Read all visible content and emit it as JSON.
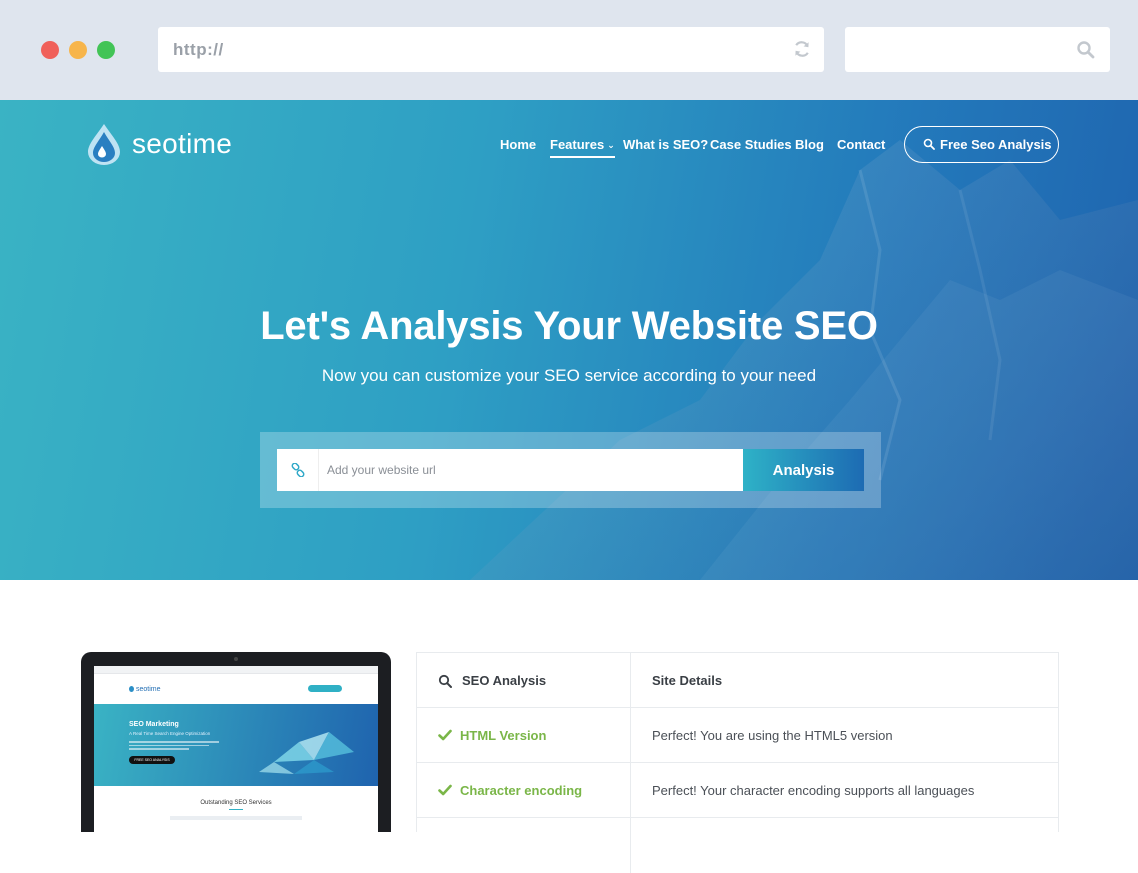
{
  "browser": {
    "url": "http://",
    "search_value": ""
  },
  "site": {
    "logo_text": "seotime",
    "nav": [
      {
        "label": "Home"
      },
      {
        "label": "Features"
      },
      {
        "label": "What is SEO?"
      },
      {
        "label": "Case Studies"
      },
      {
        "label": "Blog"
      },
      {
        "label": "Contact"
      }
    ],
    "cta_label": "Free Seo Analysis"
  },
  "hero": {
    "title": "Let's Analysis Your Website SEO",
    "subtitle": "Now you can customize your SEO service according to your need",
    "input_placeholder": "Add your website url",
    "button_label": "Analysis"
  },
  "preview": {
    "logo_text": "seotime",
    "hero_title": "SEO Marketing",
    "hero_subtitle": "A Real Time Search Engine Optimization",
    "button_label": "FREE SEO ANALYSIS",
    "section_title": "Outstanding SEO Services"
  },
  "analysis": {
    "header_left": "SEO Analysis",
    "header_right": "Site Details",
    "rows": [
      {
        "label": "HTML Version",
        "detail": "Perfect! You are using the HTML5 version"
      },
      {
        "label": "Character encoding",
        "detail": "Perfect! Your character encoding supports all languages"
      }
    ]
  },
  "colors": {
    "chrome_bg": "#dfe5ee",
    "hero_start": "#3ab3c4",
    "hero_end": "#1f63ae",
    "check_green": "#7ab648",
    "traffic_red": "#f0605a",
    "traffic_yellow": "#f7b54b",
    "traffic_green": "#42c456"
  },
  "icons": [
    "reload-icon",
    "search-icon",
    "water-drop-icon",
    "chevron-down-icon",
    "link-icon",
    "check-icon"
  ]
}
